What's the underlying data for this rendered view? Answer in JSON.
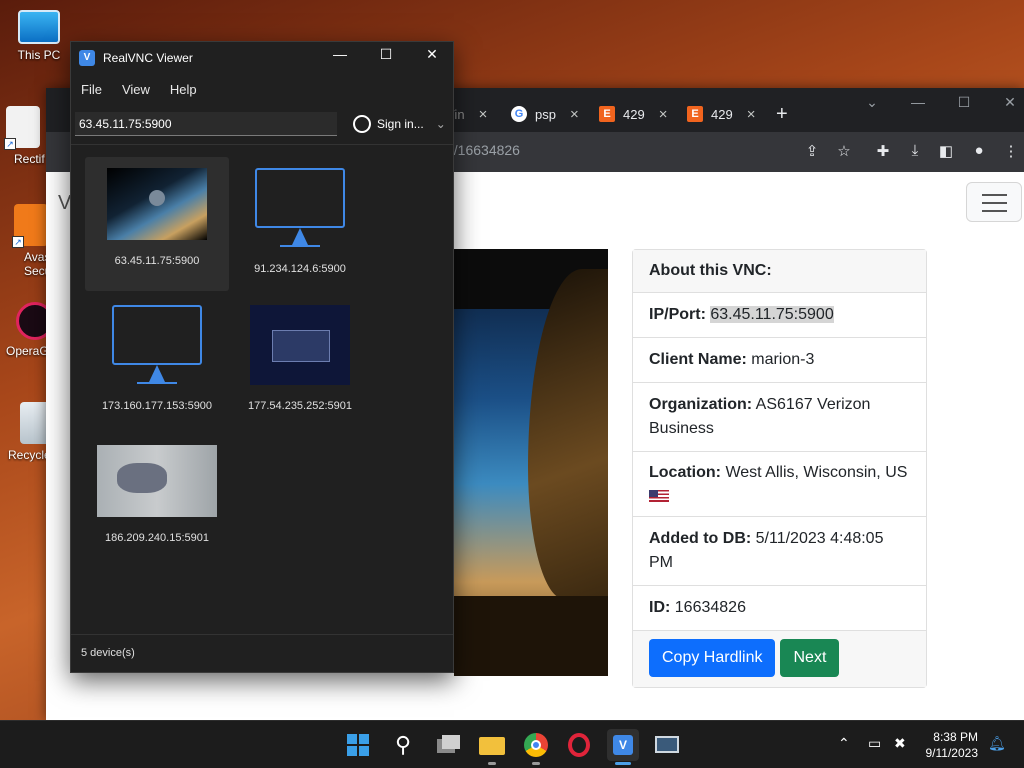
{
  "desktop": {
    "icons": [
      {
        "label": "This PC"
      },
      {
        "label": "Rectif Contr"
      },
      {
        "label": "Avas Secure"
      },
      {
        "label": "OperaG"
      },
      {
        "label": "Recycle"
      }
    ]
  },
  "browser": {
    "tabs": [
      {
        "label": "Vin",
        "favicon": ""
      },
      {
        "label": "psp",
        "favicon": "G"
      },
      {
        "label": "429",
        "favicon": "E"
      },
      {
        "label": "429",
        "favicon": "E"
      }
    ],
    "new_tab_label": "+",
    "url_fragment": "d/16634826",
    "page_title_fragment": "V",
    "vnc_info": {
      "header": "About this VNC:",
      "rows": [
        {
          "label": "IP/Port:",
          "value": "63.45.11.75:5900"
        },
        {
          "label": "Client Name:",
          "value": "marion-3"
        },
        {
          "label": "Organization:",
          "value": "AS6167 Verizon Business"
        },
        {
          "label": "Location:",
          "value": "West Allis, Wisconsin, US"
        },
        {
          "label": "Added to DB:",
          "value": "5/11/2023 4:48:05 PM"
        },
        {
          "label": "ID:",
          "value": "16634826"
        }
      ],
      "copy_button": "Copy Hardlink",
      "next_button": "Next"
    }
  },
  "vnc_viewer": {
    "title": "RealVNC Viewer",
    "menu": [
      "File",
      "View",
      "Help"
    ],
    "search_value": "63.45.11.75:5900",
    "sign_in": "Sign in...",
    "devices": [
      {
        "label": "63.45.11.75:5900"
      },
      {
        "label": "91.234.124.6:5900"
      },
      {
        "label": "173.160.177.153:5900"
      },
      {
        "label": "177.54.235.252:5901"
      },
      {
        "label": "186.209.240.15:5901"
      }
    ],
    "status": "5 device(s)"
  },
  "taskbar": {
    "time": "8:38 PM",
    "date": "9/11/2023"
  },
  "colors": {
    "accent": "#3f88e6",
    "primary_button": "#0d6efd",
    "success_button": "#198754"
  }
}
